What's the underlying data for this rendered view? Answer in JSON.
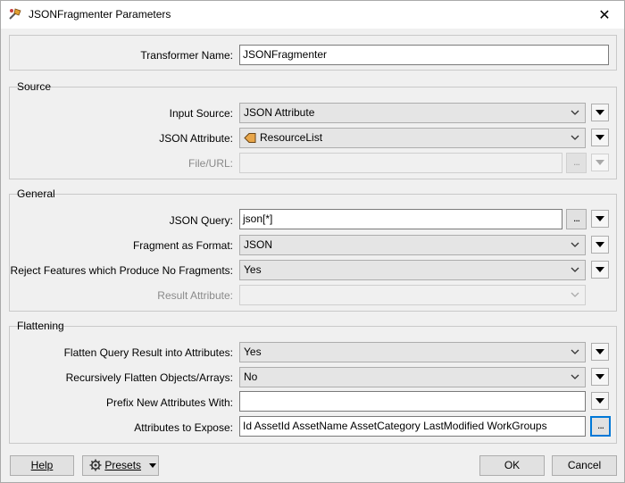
{
  "window": {
    "title": "JSONFragmenter Parameters",
    "close_glyph": "✕"
  },
  "transformer": {
    "label": "Transformer Name:",
    "value": "JSONFragmenter"
  },
  "source": {
    "title": "Source",
    "input_source": {
      "label": "Input Source:",
      "value": "JSON Attribute"
    },
    "json_attribute": {
      "label": "JSON Attribute:",
      "value": "ResourceList"
    },
    "file_url": {
      "label": "File/URL:",
      "value": ""
    }
  },
  "general": {
    "title": "General",
    "json_query": {
      "label": "JSON Query:",
      "value": "json[*]"
    },
    "fragment_format": {
      "label": "Fragment as Format:",
      "value": "JSON"
    },
    "reject_features": {
      "label": "Reject Features which Produce No Fragments:",
      "value": "Yes"
    },
    "result_attribute": {
      "label": "Result Attribute:",
      "value": ""
    }
  },
  "flattening": {
    "title": "Flattening",
    "flatten_query": {
      "label": "Flatten Query Result into Attributes:",
      "value": "Yes"
    },
    "recursive_flatten": {
      "label": "Recursively Flatten Objects/Arrays:",
      "value": "No"
    },
    "prefix": {
      "label": "Prefix New Attributes With:",
      "value": ""
    },
    "expose": {
      "label": "Attributes to Expose:",
      "value": "Id AssetId AssetName AssetCategory LastModified WorkGroups"
    }
  },
  "footer": {
    "help": "Help",
    "presets": "Presets",
    "ok": "OK",
    "cancel": "Cancel"
  },
  "colors": {
    "accent": "#0078d7",
    "attr_icon": "#e8a64a"
  },
  "dots_label": "..."
}
